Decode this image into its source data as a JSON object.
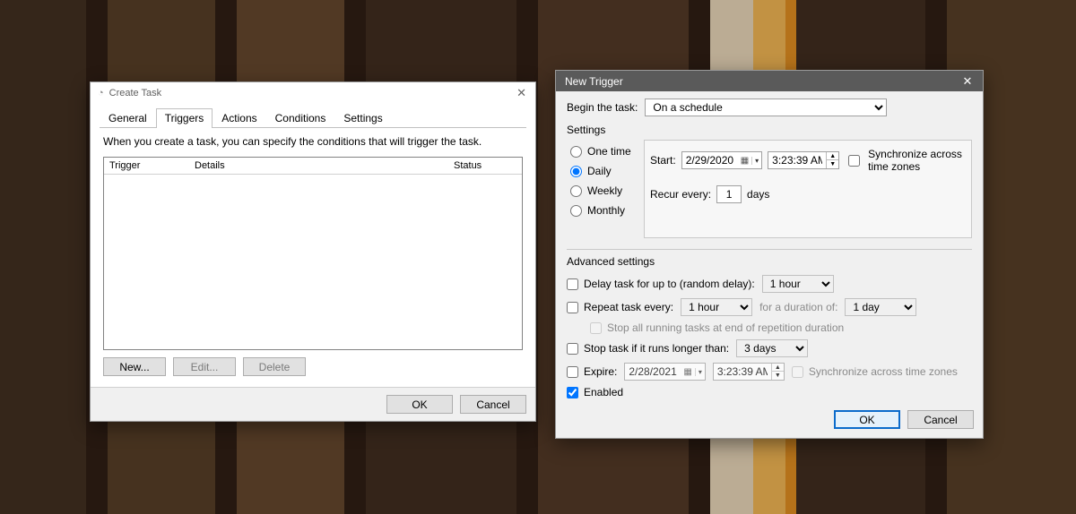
{
  "create_task": {
    "title": "Create Task",
    "tabs": {
      "general": "General",
      "triggers": "Triggers",
      "actions": "Actions",
      "conditions": "Conditions",
      "settings": "Settings"
    },
    "info": "When you create a task, you can specify the conditions that will trigger the task.",
    "list_headers": {
      "trigger": "Trigger",
      "details": "Details",
      "status": "Status"
    },
    "buttons": {
      "new": "New...",
      "edit": "Edit...",
      "delete": "Delete"
    },
    "footer": {
      "ok": "OK",
      "cancel": "Cancel"
    }
  },
  "new_trigger": {
    "title": "New Trigger",
    "begin_label": "Begin the task:",
    "begin_value": "On a schedule",
    "settings_label": "Settings",
    "schedule": {
      "one_time": "One time",
      "daily": "Daily",
      "weekly": "Weekly",
      "monthly": "Monthly"
    },
    "start_label": "Start:",
    "start_date": "2/29/2020",
    "start_time": "3:23:39 AM",
    "sync_tz": "Synchronize across time zones",
    "recur_label": "Recur every:",
    "recur_value": "1",
    "recur_unit": "days",
    "advanced_label": "Advanced settings",
    "delay_label": "Delay task for up to (random delay):",
    "delay_value": "1 hour",
    "repeat_label": "Repeat task every:",
    "repeat_value": "1 hour",
    "repeat_dur_label": "for a duration of:",
    "repeat_dur_value": "1 day",
    "stop_all_label": "Stop all running tasks at end of repetition duration",
    "stop_if_label": "Stop task if it runs longer than:",
    "stop_if_value": "3 days",
    "expire_label": "Expire:",
    "expire_date": "2/28/2021",
    "expire_time": "3:23:39 AM",
    "expire_sync": "Synchronize across time zones",
    "enabled_label": "Enabled",
    "footer": {
      "ok": "OK",
      "cancel": "Cancel"
    }
  }
}
